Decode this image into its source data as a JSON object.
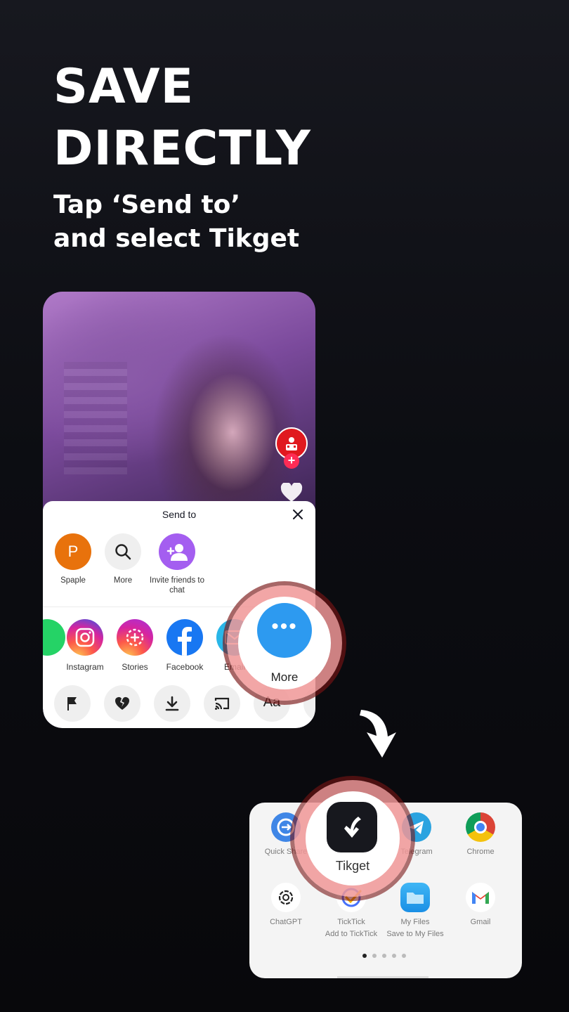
{
  "headline": {
    "line1": "SAVE",
    "line2": "DIRECTLY"
  },
  "subline": {
    "line1": "Tap ‘Send to’",
    "line2": "and select Tikget"
  },
  "sheet": {
    "title": "Send to",
    "contacts": [
      {
        "initial": "P",
        "label": "Spaple"
      },
      {
        "label": "More"
      },
      {
        "label": "Invite friends to chat"
      }
    ],
    "apps": [
      {
        "label": "Instagram"
      },
      {
        "label": "Stories"
      },
      {
        "label": "Facebook"
      },
      {
        "label": "Email"
      }
    ],
    "tools": {
      "captions_label": "Aa"
    }
  },
  "more_button": {
    "label": "More",
    "dots": "•••"
  },
  "share_grid": {
    "items": [
      {
        "label": "Quick Share"
      },
      {
        "label": "Tikget"
      },
      {
        "label": "Telegram"
      },
      {
        "label": "Chrome"
      },
      {
        "label": "ChatGPT"
      },
      {
        "label": "TickTick",
        "sublabel": "Add to TickTick"
      },
      {
        "label": "My Files",
        "sublabel": "Save to My Files"
      },
      {
        "label": "Gmail"
      }
    ],
    "page_count": 5,
    "active_page": 1
  },
  "colors": {
    "tiktok_red": "#fe2c55",
    "more_blue": "#2d9af0",
    "highlight_ring": "#f09696"
  }
}
